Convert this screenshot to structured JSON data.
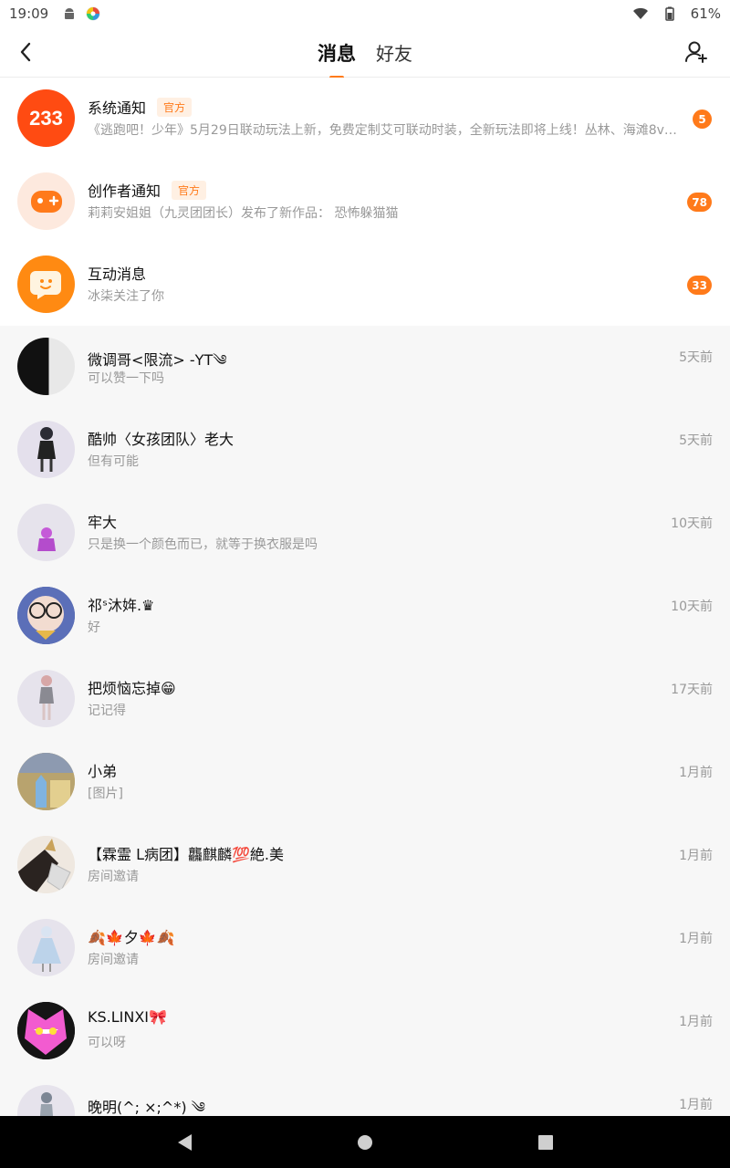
{
  "status_bar": {
    "time": "19:09",
    "battery": "61%",
    "icons": [
      "android-icon",
      "app-notification-icon",
      "wifi-icon",
      "battery-icon"
    ]
  },
  "header": {
    "tabs": [
      {
        "label": "消息",
        "active": true
      },
      {
        "label": "好友",
        "active": false
      }
    ],
    "icons": [
      "back-arrow-icon",
      "add-friend-icon"
    ],
    "accent_color": "#ff7a1a"
  },
  "official": [
    {
      "name": "系统通知",
      "tag": "官方",
      "preview": "《逃跑吧！少年》5月29日联动玩法上新，免费定制艾可联动时装，全新玩法即将上线！丛林、海滩8v2...",
      "count": "5",
      "avatar_text": "233"
    },
    {
      "name": "创作者通知",
      "tag": "官方",
      "preview": "莉莉安姐姐（九灵团团长）发布了新作品：  恐怖躲猫猫",
      "count": "78"
    },
    {
      "name": "互动消息",
      "tag": "",
      "preview": "冰柒关注了你",
      "count": "33"
    }
  ],
  "chats": [
    {
      "name": "微调哥<限流> -YT༄",
      "preview": "可以赞一下吗",
      "time": "5天前"
    },
    {
      "name": "酷帅〈女孩团队〉老大",
      "preview": "但有可能",
      "time": "5天前"
    },
    {
      "name": "牢大",
      "preview": "只是换一个颜色而已，就等于换衣服是吗",
      "time": "10天前"
    },
    {
      "name": "祁ˢ沐姩.♛",
      "preview": "好",
      "time": "10天前"
    },
    {
      "name": "把烦恼忘掉😁",
      "preview": "记记得",
      "time": "17天前"
    },
    {
      "name": "小弟",
      "preview": "[图片]",
      "time": "1月前"
    },
    {
      "name": "【霖霊 ᒪ病团】龘麒麟💯絶.美",
      "preview": "房间邀请",
      "time": "1月前"
    },
    {
      "name": "🍂🍁夕🍁🍂",
      "preview": "房间邀请",
      "time": "1月前"
    },
    {
      "name": "KS.LINXI🎀",
      "preview": "可以呀",
      "time": "1月前"
    },
    {
      "name": "晚明(^; ×;^*) ༄",
      "preview": "",
      "time": "1月前"
    }
  ]
}
